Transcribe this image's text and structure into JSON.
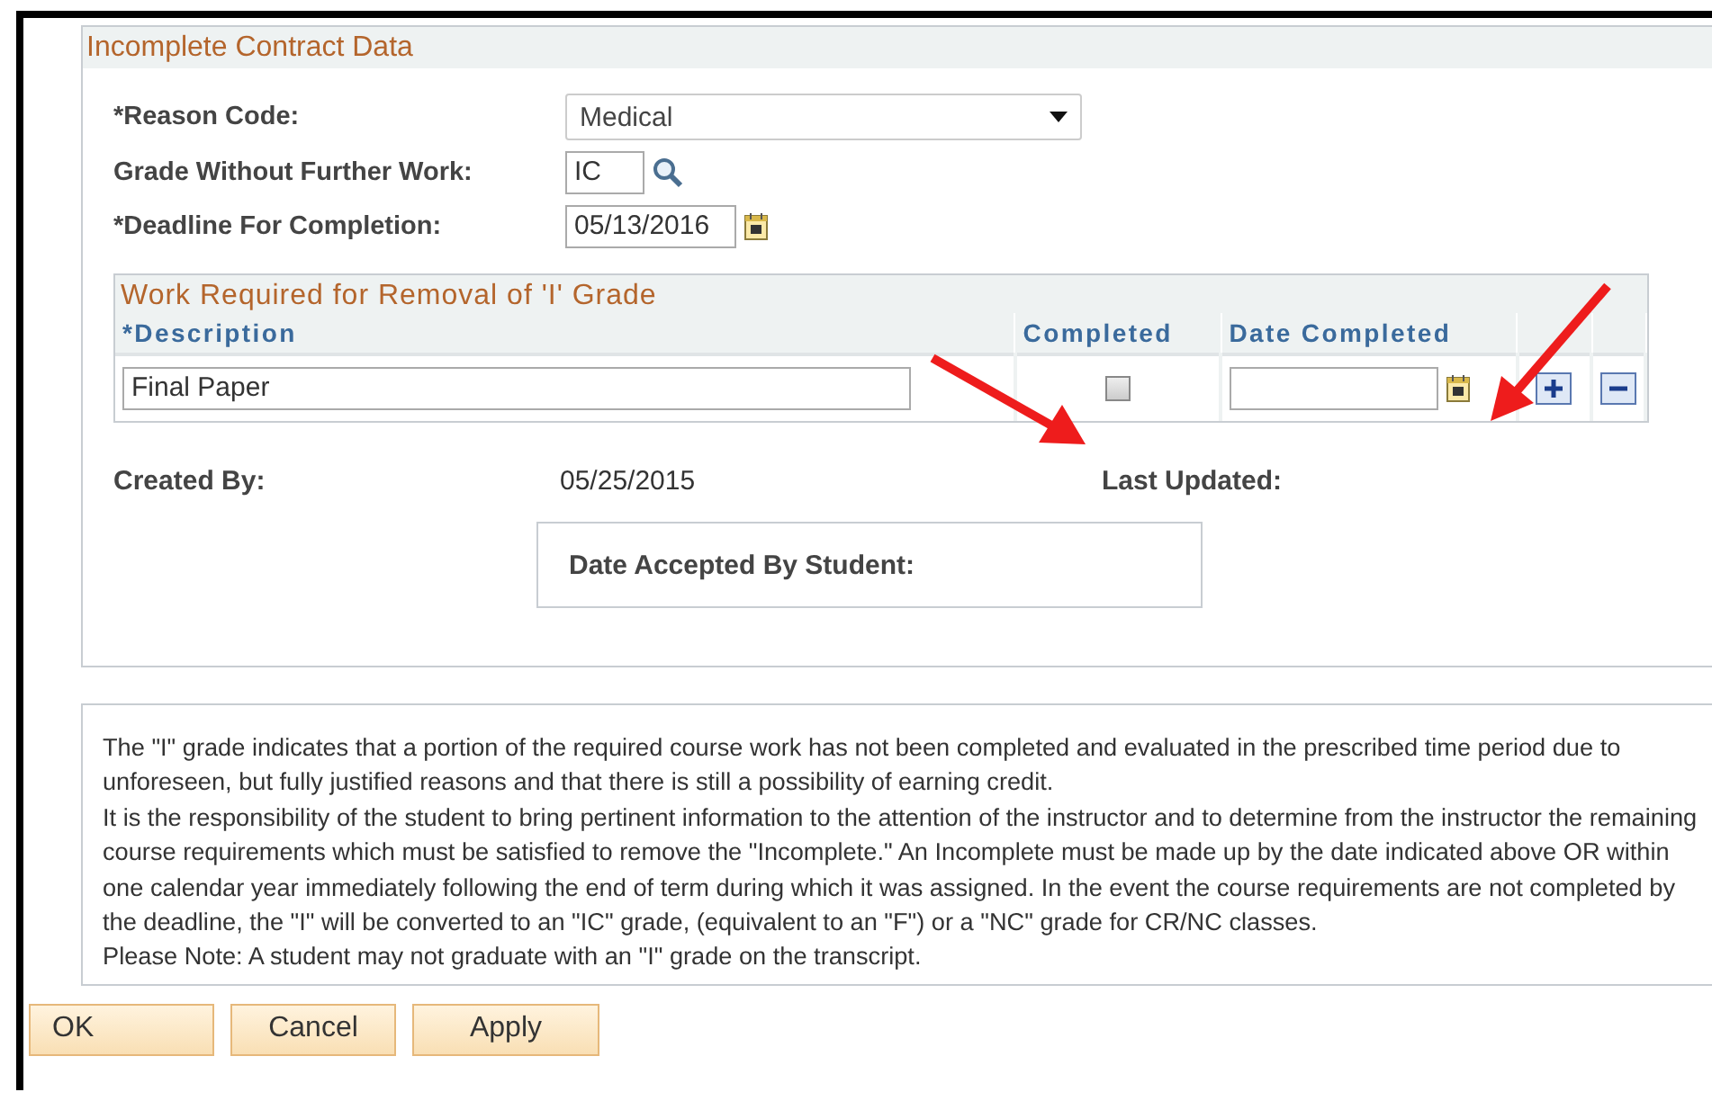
{
  "panel": {
    "title": "Incomplete Contract Data"
  },
  "fields": [
    {
      "label": "*Reason Code:",
      "kind": "dropdown",
      "value": "Medical"
    },
    {
      "label": "Grade Without Further Work:",
      "kind": "lookup",
      "value": "IC"
    },
    {
      "label": "*Deadline For Completion:",
      "kind": "date",
      "value": "05/13/2016"
    }
  ],
  "work_grid": {
    "title": "Work Required for Removal of 'I' Grade",
    "columns": [
      "*Description",
      "Completed",
      "Date Completed"
    ],
    "rows": [
      {
        "description": "Final Paper",
        "completed": false
      }
    ]
  },
  "info": [
    {
      "label": "Created By:",
      "value": "05/25/2015"
    },
    {
      "label": "Last Updated:"
    }
  ],
  "acceptance": {
    "label": "Date Accepted By Student:"
  },
  "notice": [
    "The \"I\" grade indicates that a portion of the required course work has not been completed and evaluated in the prescribed time period due to unforeseen, but fully justified reasons and that there is still a possibility of earning credit.",
    "It is the responsibility of the student to bring pertinent information to the attention of the instructor and to determine from the instructor the remaining course requirements which must be satisfied to remove the \"Incomplete.\"  An Incomplete must be made up by the date indicated above OR within one calendar year immediately following the end of term during which it was assigned.  In the event the course requirements are not completed by the deadline, the \"I\" will be converted to an \"IC\" grade, (equivalent to an \"F\") or a \"NC\" grade for CR/NC classes.",
    "Please Note:  A student may not graduate with an \"I\" grade on the transcript."
  ],
  "buttons": [
    "OK",
    "Cancel",
    "Apply"
  ]
}
